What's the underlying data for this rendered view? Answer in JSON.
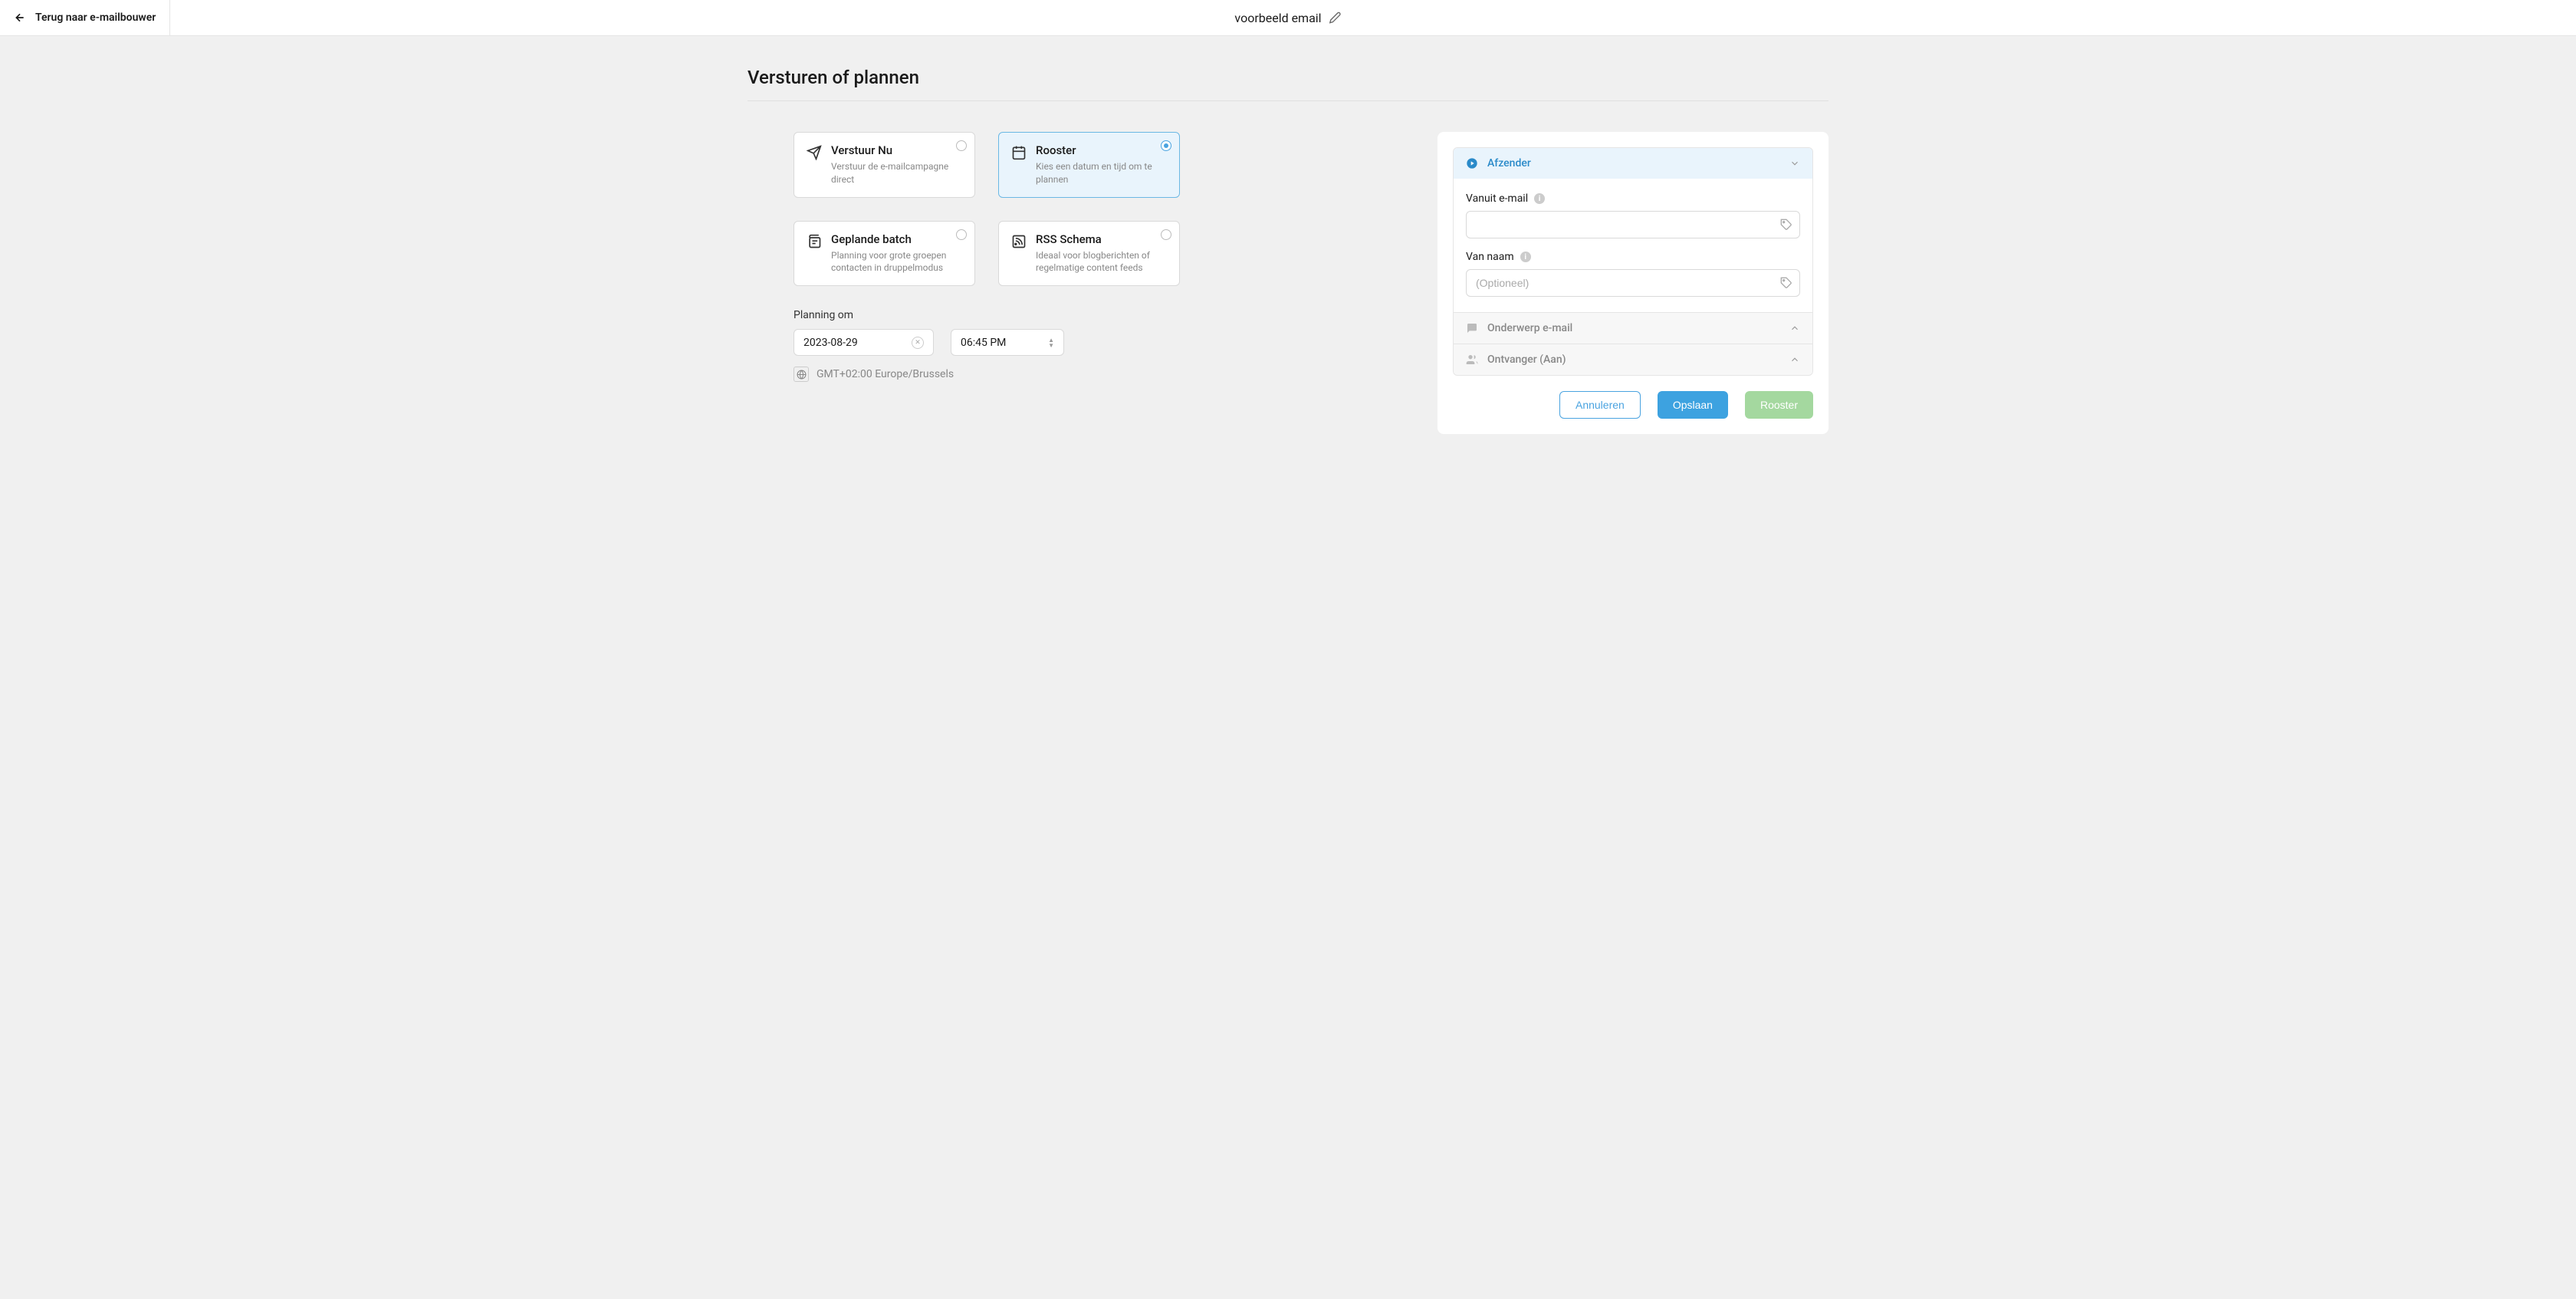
{
  "header": {
    "back_label": "Terug naar e-mailbouwer",
    "title": "voorbeeld email"
  },
  "page_title": "Versturen of plannen",
  "send_options": [
    {
      "id": "send-now",
      "title": "Verstuur Nu",
      "desc": "Verstuur de e-mailcampagne direct",
      "selected": false,
      "icon": "send"
    },
    {
      "id": "roster",
      "title": "Rooster",
      "desc": "Kies een datum en tijd om te plannen",
      "selected": true,
      "icon": "calendar"
    },
    {
      "id": "batch",
      "title": "Geplande batch",
      "desc": "Planning voor grote groepen contacten in druppelmodus",
      "selected": false,
      "icon": "calendar-copy"
    },
    {
      "id": "rss",
      "title": "RSS Schema",
      "desc": "Ideaal voor blogberichten of regelmatige content feeds",
      "selected": false,
      "icon": "rss"
    }
  ],
  "schedule": {
    "label": "Planning om",
    "date": "2023-08-29",
    "time": "06:45 PM",
    "tz": "GMT+02:00 Europe/Brussels"
  },
  "panel": {
    "sections": {
      "sender": {
        "title": "Afzender",
        "from_email_label": "Vanuit e-mail",
        "from_email_value": "",
        "from_name_label": "Van naam",
        "from_name_placeholder": "(Optioneel)"
      },
      "subject": {
        "title": "Onderwerp e-mail"
      },
      "recipient": {
        "title": "Ontvanger (Aan)"
      }
    },
    "buttons": {
      "cancel": "Annuleren",
      "save": "Opslaan",
      "schedule": "Rooster"
    }
  }
}
